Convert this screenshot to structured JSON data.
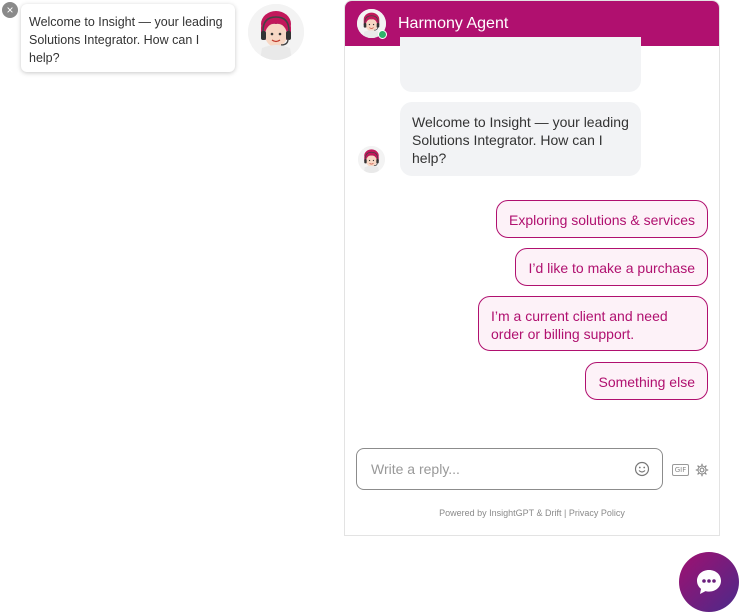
{
  "preview": {
    "close_glyph": "×",
    "message": "Welcome to Insight  — your leading Solutions Integrator. How can I help?"
  },
  "header": {
    "title": "Harmony Agent",
    "color": "#b0106f",
    "status_color": "#2fb36b"
  },
  "conversation": {
    "welcome_message": "Welcome to Insight — your leading Solutions Integrator. How can I help?"
  },
  "quick_replies": [
    "Exploring solutions & services",
    "I’d like to make a purchase",
    "I’m a current client and need order or billing support.",
    "Something else"
  ],
  "composer": {
    "placeholder": "Write a reply...",
    "gif_label": "GIF"
  },
  "footer": {
    "powered_by": "Powered by InsightGPT & Drift",
    "separator": " | ",
    "privacy_link": "Privacy Policy"
  },
  "icons": {
    "close": "close-icon",
    "avatar": "agent-avatar-icon",
    "emoji": "emoji-icon",
    "gif": "gif-icon",
    "settings": "gear-icon",
    "launcher": "chat-bubble-icon"
  },
  "colors": {
    "accent": "#b0106f",
    "quick_reply_bg": "#fdf2f8",
    "bubble_bg": "#f2f3f5"
  }
}
